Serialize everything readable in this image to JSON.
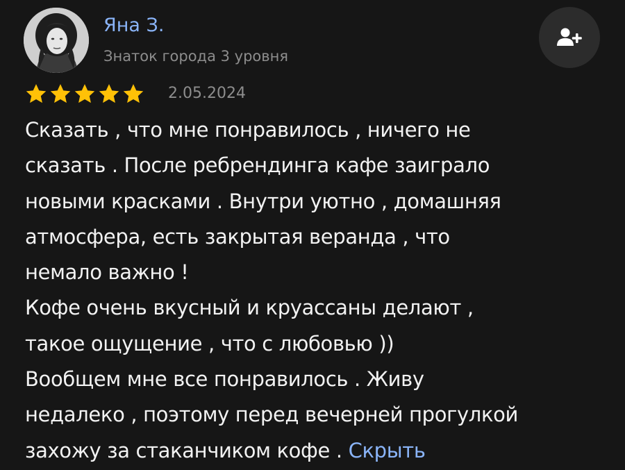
{
  "author": {
    "name": "Яна З.",
    "level": "Знаток города 3 уровня",
    "avatar_icon": "user-avatar-photo"
  },
  "follow_button": {
    "icon": "add-user-icon"
  },
  "rating": {
    "stars": 5,
    "max": 5,
    "color": "#ffc107"
  },
  "review": {
    "date": "2.05.2024",
    "lines": [
      "Сказать , что мне понравилось , ничего не",
      "сказать . После ребрендинга кафе заиграло",
      "новыми красками . Внутри уютно , домашняя",
      "атмосфера, есть закрытая веранда , что",
      "немало важно !",
      "Кофе очень вкусный и круассаны делают ,",
      "такое ощущение , что с любовью ))",
      "Вообщем мне все понравилось . Живу",
      "недалеко , поэтому перед вечерней прогулкой",
      "захожу за стаканчиком кофе . "
    ],
    "hide_label": "Скрыть"
  },
  "colors": {
    "background": "#161616",
    "text": "#f2f2f2",
    "secondary_text": "#8d8d8d",
    "link": "#8ab4f8",
    "button_bg": "#2c2c2c"
  }
}
